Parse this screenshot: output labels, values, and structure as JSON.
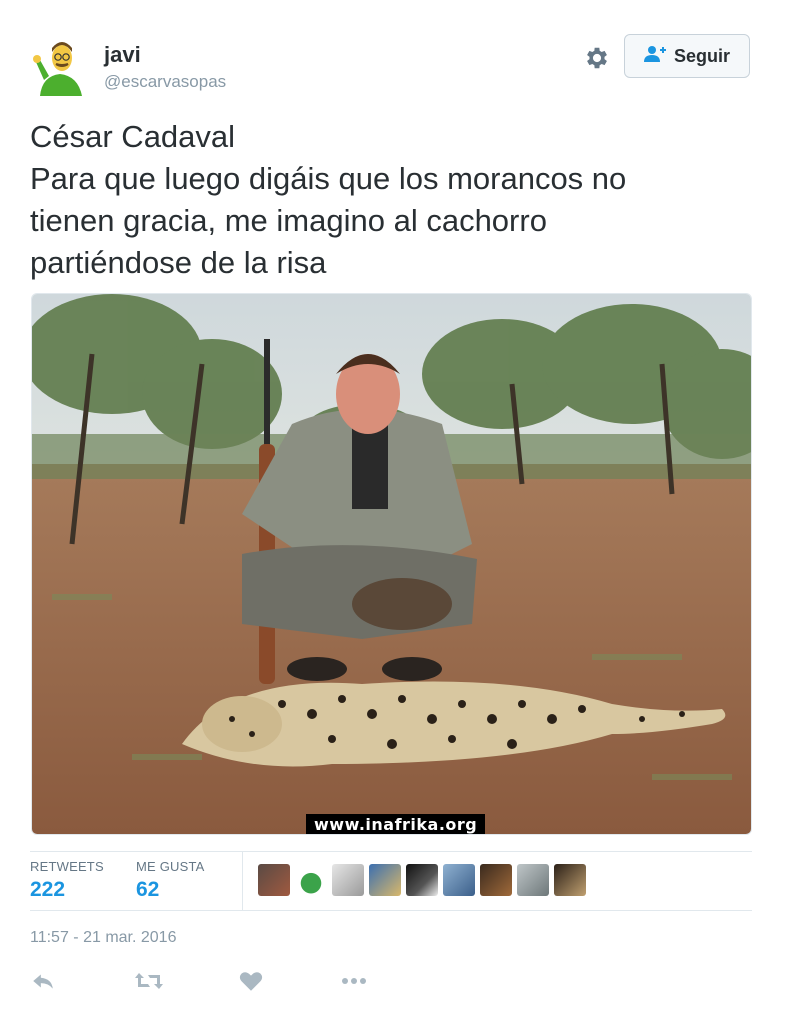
{
  "user": {
    "name": "javi",
    "handle": "@escarvasopas",
    "avatar_icon": "cartoon-character-avatar"
  },
  "header": {
    "settings_icon": "gear-icon",
    "follow_label": "Seguir",
    "follow_icon": "add-user-icon"
  },
  "tweet": {
    "lines": [
      "César Cadaval",
      "Para que luego digáis que los morancos no",
      "tienen gracia, me imagino al cachorro",
      "partiéndose de la risa"
    ],
    "photo_watermark": "www.inafrika.org"
  },
  "stats": {
    "retweets_label": "RETWEETS",
    "retweets_value": "222",
    "likes_label": "ME GUSTA",
    "likes_value": "62",
    "liker_avatars": [
      "avatar-1",
      "avatar-2",
      "avatar-3",
      "avatar-4",
      "avatar-5",
      "avatar-6",
      "avatar-7",
      "avatar-8",
      "avatar-9"
    ]
  },
  "timestamp": "11:57 - 21 mar. 2016",
  "actions": [
    "reply-icon",
    "retweet-icon",
    "like-icon",
    "more-icon"
  ],
  "colors": {
    "accent": "#1b95e0",
    "text": "#292f33",
    "muted": "#8899a6",
    "border": "#e1e8ed"
  }
}
